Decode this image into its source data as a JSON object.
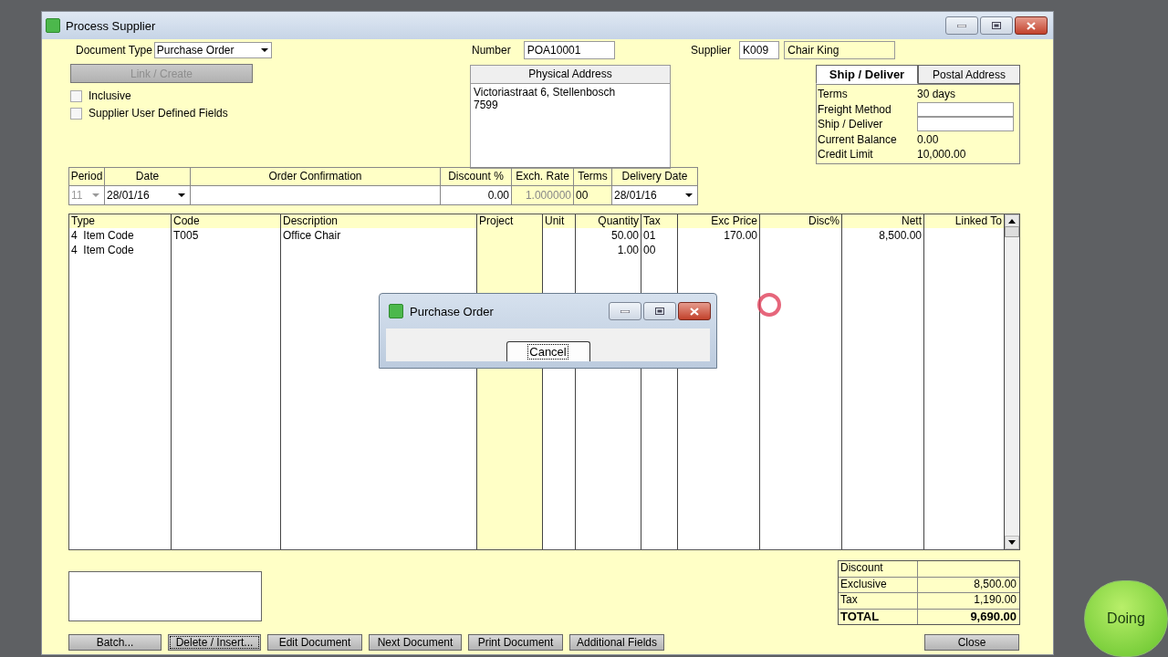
{
  "window": {
    "title": "Process Supplier"
  },
  "document_type": {
    "label": "Document Type",
    "value": "Purchase Order"
  },
  "link_button": {
    "label": "Link / Create",
    "disabled": true
  },
  "checkboxes": [
    {
      "label": "Inclusive",
      "checked": false
    },
    {
      "label": "Supplier User Defined Fields",
      "checked": false
    }
  ],
  "number": {
    "label": "Number",
    "value": "POA10001"
  },
  "physical_address": {
    "title": "Physical Address",
    "lines": [
      "Victoriastraat 6, Stellenbosch",
      "7599"
    ]
  },
  "supplier": {
    "label": "Supplier",
    "code": "K009",
    "name": "Chair King"
  },
  "address_tabs": [
    {
      "label": "Ship / Deliver",
      "selected": true
    },
    {
      "label": "Postal Address",
      "selected": false
    }
  ],
  "supplier_info": [
    {
      "label": "Terms",
      "kind": "text",
      "value": "30 days"
    },
    {
      "label": "Freight Method",
      "kind": "field"
    },
    {
      "label": "Ship / Deliver",
      "kind": "field"
    },
    {
      "label": "Current Balance",
      "kind": "text",
      "value": "0.00"
    },
    {
      "label": "Credit Limit",
      "kind": "text",
      "value": "10,000.00"
    }
  ],
  "header_fields": [
    {
      "label": "Period",
      "kind": "combo",
      "value": "11"
    },
    {
      "label": "Date",
      "kind": "dropdown",
      "value": "28/01/16"
    },
    {
      "label": "Order Confirmation",
      "kind": "field"
    },
    {
      "label": "Discount %",
      "kind": "number",
      "value": "0.00"
    },
    {
      "label": "Exch. Rate",
      "kind": "readonly",
      "value": "1.000000"
    },
    {
      "label": "Terms",
      "kind": "text",
      "value": "00"
    },
    {
      "label": "Delivery Date",
      "kind": "dropdown",
      "value": "28/01/16"
    }
  ],
  "lines": {
    "columns": [
      {
        "label": "Type",
        "kind": "text",
        "shaded": false
      },
      {
        "label": "Code",
        "kind": "text",
        "shaded": false
      },
      {
        "label": "Description",
        "kind": "text",
        "shaded": false
      },
      {
        "label": "Project",
        "kind": "text",
        "shaded": true
      },
      {
        "label": "Unit",
        "kind": "text",
        "shaded": false
      },
      {
        "label": "Quantity",
        "kind": "number",
        "shaded": false
      },
      {
        "label": "Tax",
        "kind": "text",
        "shaded": false
      },
      {
        "label": "Exc Price",
        "kind": "number",
        "shaded": false
      },
      {
        "label": "Disc%",
        "kind": "number",
        "shaded": false
      },
      {
        "label": "Nett",
        "kind": "number",
        "shaded": false
      },
      {
        "label": "Linked To",
        "kind": "number",
        "shaded": false
      }
    ],
    "rows": [
      [
        "4  Item Code",
        "T005",
        "Office Chair",
        null,
        null,
        "50.00",
        "01",
        "170.00",
        null,
        "8,500.00",
        null
      ],
      [
        "4  Item Code",
        null,
        null,
        null,
        null,
        "1.00",
        "00",
        null,
        null,
        null,
        null
      ]
    ]
  },
  "totals": [
    {
      "label": "Discount",
      "kind": "line"
    },
    {
      "label": "Exclusive",
      "kind": "line",
      "value": "8,500.00"
    },
    {
      "label": "Tax",
      "kind": "line",
      "value": "1,190.00"
    },
    {
      "label": "TOTAL",
      "kind": "total",
      "value": "9,690.00"
    }
  ],
  "buttons": [
    {
      "label": "Batch...",
      "focused": false
    },
    {
      "label": "Delete / Insert...",
      "focused": true
    },
    {
      "label": "Edit Document",
      "focused": false
    },
    {
      "label": "Next Document",
      "focused": false
    },
    {
      "label": "Print Document",
      "focused": false
    },
    {
      "label": "Additional Fields",
      "focused": false
    }
  ],
  "close_button": {
    "label": "Close"
  },
  "dialog": {
    "title": "Purchase Order",
    "button": "Cancel"
  },
  "badge": {
    "label": "Doing"
  }
}
